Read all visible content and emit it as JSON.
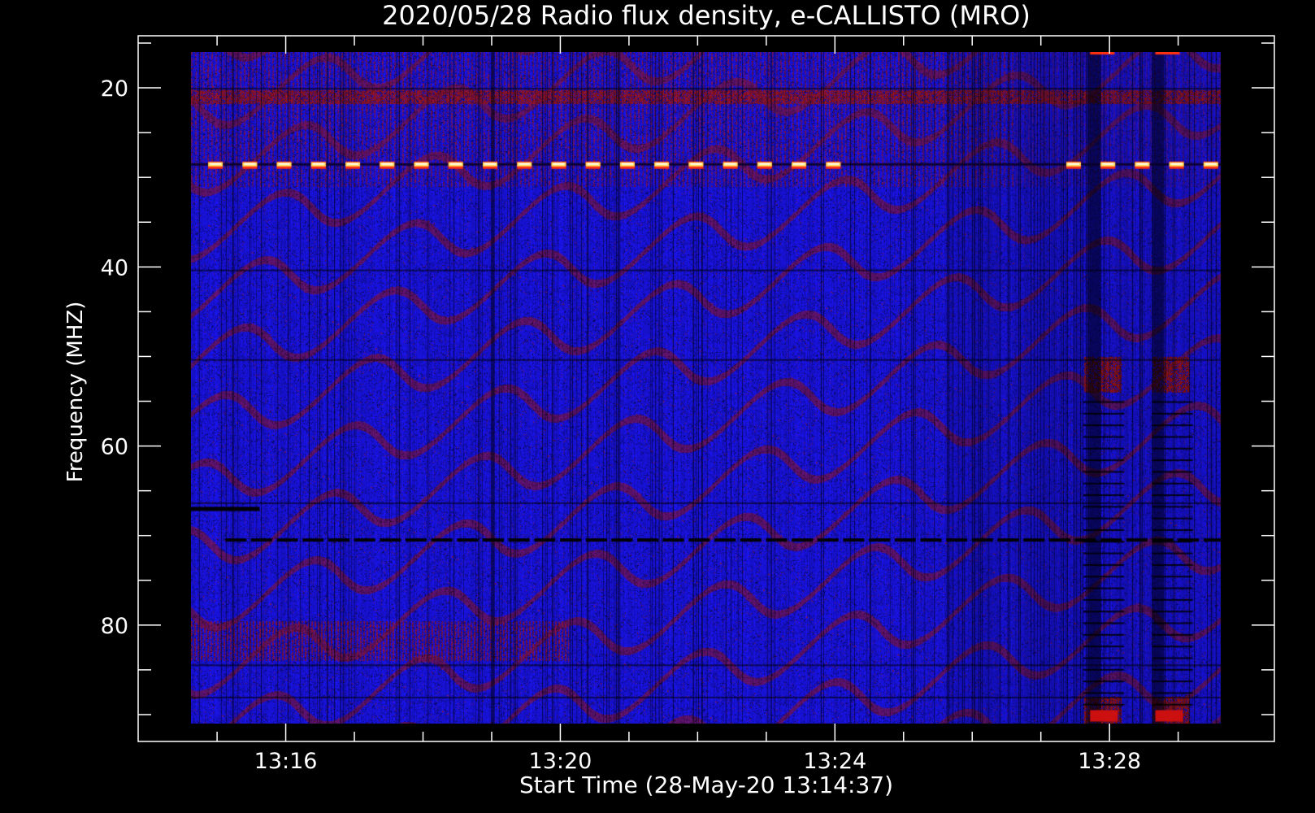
{
  "chart_data": {
    "type": "heatmap",
    "title": "2020/05/28  Radio flux density, e-CALLISTO (MRO)",
    "xlabel": "Start Time (28-May-20 13:14:37)",
    "ylabel": "Frequency (MHZ)",
    "x_ticks": [
      "13:16",
      "13:20",
      "13:24",
      "13:28"
    ],
    "x_tick_minutes": [
      1.38,
      5.38,
      9.38,
      13.38
    ],
    "y_ticks": [
      "20",
      "40",
      "60",
      "80"
    ],
    "y_tick_values": [
      20,
      40,
      60,
      80
    ],
    "xlim_minutes": [
      0,
      15
    ],
    "ylim": [
      16,
      91
    ],
    "y_inverted": true,
    "colors": {
      "background": "#000000",
      "base": "#1a14e8",
      "warm": "#a01414",
      "hot": "#ff3010",
      "bright": "#ffe060",
      "peak": "#ffffff"
    },
    "features": [
      {
        "name": "interference band",
        "freq_mhz": 21,
        "start_minute": 0,
        "end_minute": 15
      },
      {
        "name": "pulsed carrier",
        "freq_mhz": 28.5,
        "start_minute": 0.25,
        "end_minute": 15
      },
      {
        "name": "pulsed carrier",
        "freq_mhz": 70.5,
        "start_minute": 0.5,
        "end_minute": 15
      },
      {
        "name": "low band activity",
        "freq_mhz": 82,
        "start_minute": 0,
        "end_minute": 5.5
      },
      {
        "name": "broadband burst",
        "freq_mhz": 60,
        "start_minute": 13.0,
        "end_minute": 13.6
      },
      {
        "name": "broadband burst",
        "freq_mhz": 60,
        "start_minute": 14.0,
        "end_minute": 14.6
      }
    ]
  }
}
